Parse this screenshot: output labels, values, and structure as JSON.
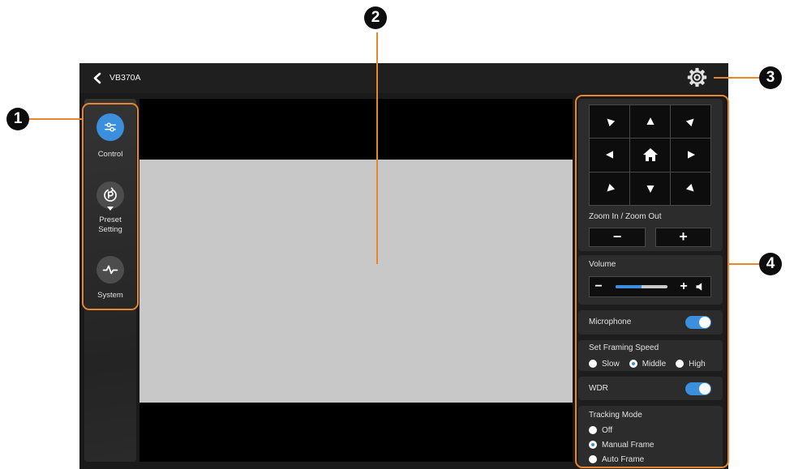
{
  "callouts": [
    {
      "number": "1"
    },
    {
      "number": "2"
    },
    {
      "number": "3"
    },
    {
      "number": "4"
    }
  ],
  "colors": {
    "callout_line": "#e8862b",
    "accent": "#3b8fdc",
    "preview_image": "#c8c8c8"
  },
  "header": {
    "back_icon": "chevron-left-icon",
    "title": "VB370A",
    "settings_icon": "gear-icon"
  },
  "sidebar": {
    "items": [
      {
        "label": "Control",
        "icon": "sliders-icon",
        "active": true
      },
      {
        "label": "Preset Setting",
        "icon": "preset-icon",
        "active": false,
        "has_dropdown": true
      },
      {
        "label": "System",
        "icon": "pulse-icon",
        "active": false
      }
    ]
  },
  "control_panel": {
    "ptz_pad": {
      "icons": [
        "up-left-arrow-icon",
        "up-arrow-icon",
        "up-right-arrow-icon",
        "left-arrow-icon",
        "home-icon",
        "right-arrow-icon",
        "down-left-arrow-icon",
        "down-arrow-icon",
        "down-right-arrow-icon"
      ]
    },
    "zoom": {
      "label": "Zoom In / Zoom Out",
      "zoom_out": "−",
      "zoom_in": "+"
    },
    "volume": {
      "label": "Volume",
      "decrease": "−",
      "increase": "+",
      "level_percent": 50,
      "icon": "speaker-icon"
    },
    "microphone": {
      "label": "Microphone",
      "enabled": true
    },
    "framing_speed": {
      "label": "Set Framing Speed",
      "options": [
        "Slow",
        "Middle",
        "High"
      ],
      "selected_index": 1
    },
    "wdr": {
      "label": "WDR",
      "enabled": true
    },
    "tracking_mode": {
      "label": "Tracking Mode",
      "options": [
        "Off",
        "Manual Frame",
        "Auto Frame"
      ],
      "selected_index": 1
    }
  }
}
